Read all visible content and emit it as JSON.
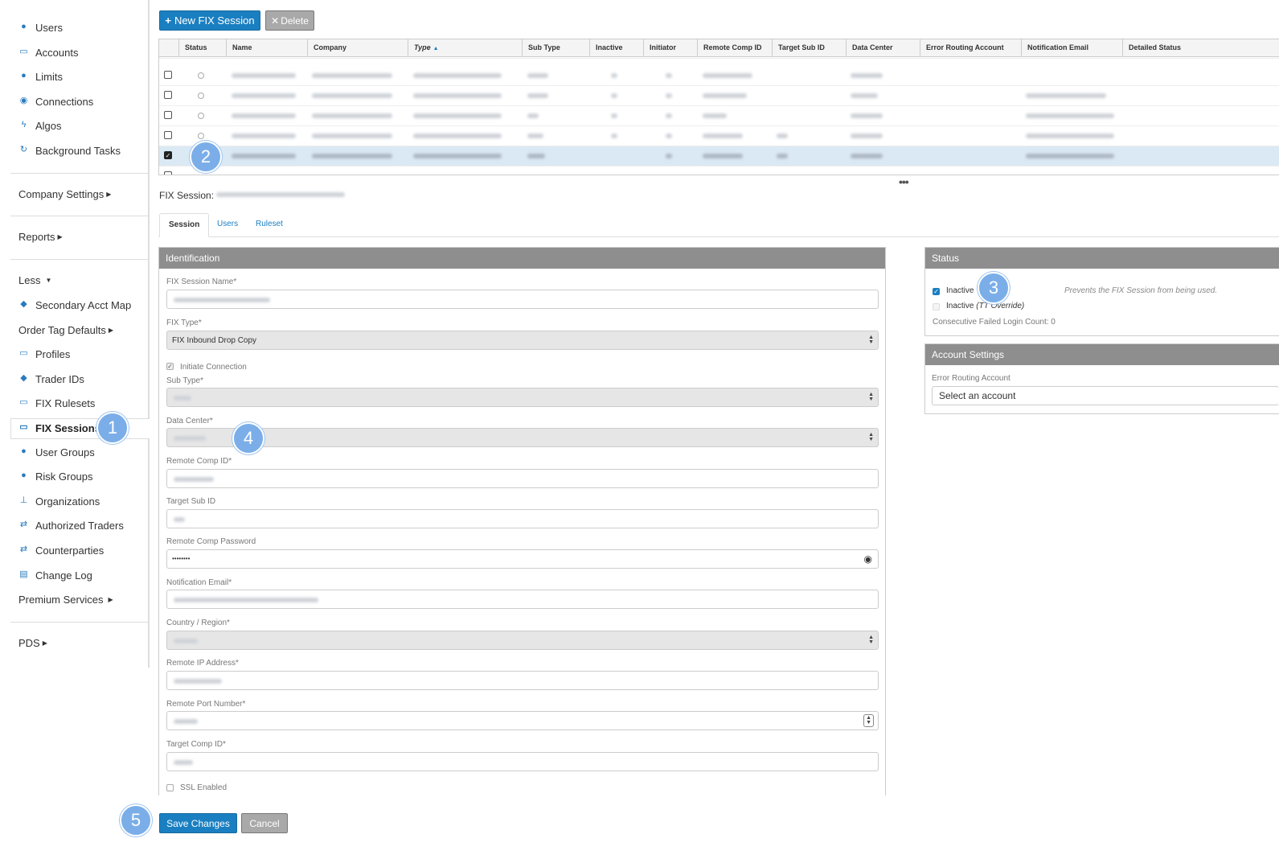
{
  "sidebar": {
    "users": "Users",
    "accounts": "Accounts",
    "limits": "Limits",
    "connections": "Connections",
    "algos": "Algos",
    "background_tasks": "Background Tasks",
    "company_settings": "Company Settings",
    "reports": "Reports",
    "less": "Less",
    "secondary_acct_map": "Secondary Acct Map",
    "order_tag_defaults": "Order Tag Defaults",
    "profiles": "Profiles",
    "trader_ids": "Trader IDs",
    "fix_rulesets": "FIX Rulesets",
    "fix_sessions": "FIX Sessions",
    "user_groups": "User Groups",
    "risk_groups": "Risk Groups",
    "organizations": "Organizations",
    "authorized_traders": "Authorized Traders",
    "counterparties": "Counterparties",
    "change_log": "Change Log",
    "premium_services": "Premium Services",
    "pds": "PDS"
  },
  "toolbar": {
    "new_label": "New FIX Session",
    "delete_label": "Delete"
  },
  "grid": {
    "columns": [
      "Status",
      "Name",
      "Company",
      "Type",
      "Sub Type",
      "Inactive",
      "Initiator",
      "Remote Comp ID",
      "Target Sub ID",
      "Data Center",
      "Error Routing Account",
      "Notification Email",
      "Detailed Status"
    ],
    "sort_column": "Type",
    "sort_direction": "ascending",
    "selected_row_index": 4
  },
  "session_title_label": "FIX Session:",
  "tabs": [
    "Session",
    "Users",
    "Ruleset"
  ],
  "identification": {
    "header": "Identification",
    "fix_session_name_label": "FIX Session Name*",
    "fix_type_label": "FIX Type*",
    "fix_type_value": "FIX Inbound Drop Copy",
    "initiate_connection_label": "Initiate Connection",
    "sub_type_label": "Sub Type*",
    "data_center_label": "Data Center*",
    "remote_comp_id_label": "Remote Comp ID*",
    "target_sub_id_label": "Target Sub ID",
    "remote_comp_password_label": "Remote Comp Password",
    "remote_comp_password_value": "••••••••",
    "notification_email_label": "Notification Email*",
    "country_region_label": "Country / Region*",
    "remote_ip_label": "Remote IP Address*",
    "remote_port_label": "Remote Port Number*",
    "target_comp_id_label": "Target Comp ID*",
    "ssl_enabled_label": "SSL Enabled"
  },
  "status_panel": {
    "header": "Status",
    "inactive_label": "Inactive",
    "inactive_checked": true,
    "inactive_override_label": "Inactive",
    "inactive_override_suffix": "(TT Override)",
    "inactive_help": "Prevents the FIX Session from being used.",
    "failed_login": "Consecutive Failed Login Count: 0"
  },
  "account_settings": {
    "header": "Account Settings",
    "error_routing_label": "Error Routing Account",
    "error_routing_placeholder": "Select an account"
  },
  "footer": {
    "save_label": "Save Changes",
    "cancel_label": "Cancel"
  },
  "badges": [
    "1",
    "2",
    "3",
    "4",
    "5"
  ],
  "colors": {
    "accent": "#1a7fc1",
    "panel_header": "#8e8e8e",
    "badge": "#7baee8",
    "selected_row": "#dbe9f4"
  }
}
